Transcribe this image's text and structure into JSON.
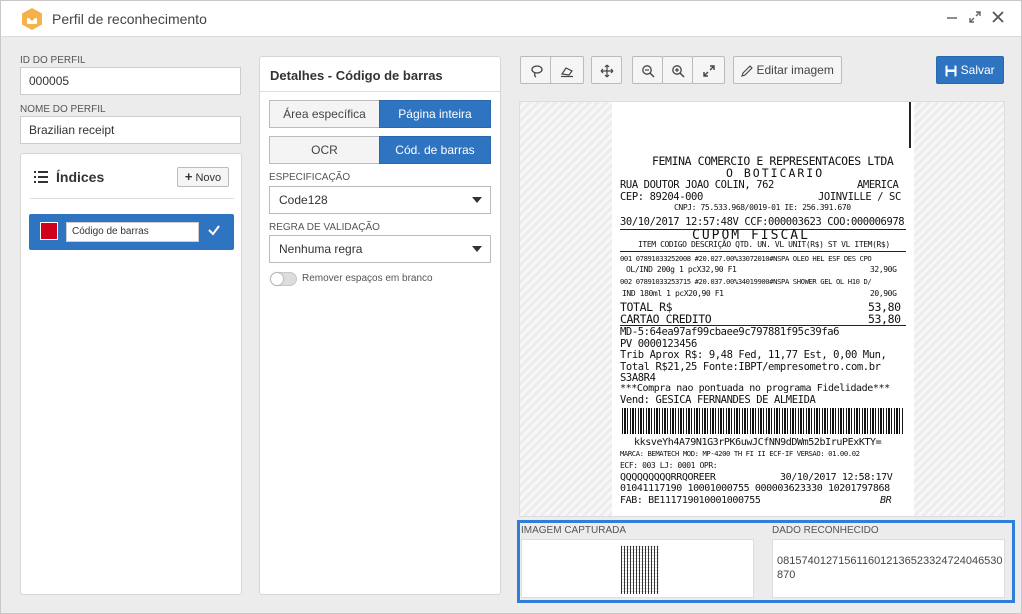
{
  "window": {
    "title": "Perfil de reconhecimento"
  },
  "left": {
    "id_label": "ID DO PERFIL",
    "id_value": "000005",
    "name_label": "NOME DO PERFIL",
    "name_value": "Brazilian receipt",
    "indices_title": "Índices",
    "new_button": "Novo",
    "index_item": {
      "label": "Código de barras",
      "color": "#d0021b"
    }
  },
  "details": {
    "title": "Detalhes - Código de barras",
    "area_specific": "Área específica",
    "full_page": "Página inteira",
    "ocr": "OCR",
    "barcode": "Cód. de barras",
    "spec_label": "ESPECIFICAÇÃO",
    "spec_value": "Code128",
    "rule_label": "REGRA DE VALIDAÇÃO",
    "rule_value": "Nenhuma regra",
    "remove_spaces": "Remover espaços em branco"
  },
  "toolbar": {
    "edit_image": "Editar imagem",
    "save": "Salvar"
  },
  "receipt": {
    "lines": [
      "FEMINA COMERCIO E REPRESENTACOES LTDA",
      "O BOTICARIO",
      "RUA DOUTOR JOAO COLIN, 762",
      "AMERICA",
      "CEP: 89204-000",
      "JOINVILLE / SC",
      "CNPJ: 75.533.968/0019-01 IE: 256.391.670",
      "30/10/2017 12:57:48V CCF:000003623 COO:000006978",
      "CUPOM FISCAL",
      "ITEM CODIGO DESCRIÇÃO QTD. UN. VL UNIT(R$) ST VL ITEM(R$)",
      "001 07891033252008 #20.027.00%33072010#NSPA OLEO HEL ESF DES CPO",
      "OL/IND 200g 1 pcX32,90 F1",
      "32,90G",
      "002 07891033253715 #20.037.00%34019900#NSPA SHOWER GEL OL H10 D/",
      "IND 180ml 1 pcX20,90 F1",
      "20,90G",
      "TOTAL R$",
      "53,80",
      "CARTAO CREDITO",
      "53,80",
      "MD-5:64ea97af99cbaee9c797881f95c39fa6",
      "PV 0000123456",
      "Trib Aprox R$: 9,48 Fed, 11,77 Est, 0,00 Mun,",
      "Total R$21,25 Fonte:IBPT/empresometro.com.br",
      "S3A8R4",
      "***Compra nao pontuada no programa Fidelidade***",
      "Vend: GESICA FERNANDES DE ALMEIDA",
      "kksveYh4A79N1G3rPK6uwJCfNN9dDWm52bIruPExKTY=",
      "MARCA: BEMATECH MOD: MP-4200 TH FI II ECF-IF VERSAO: 01.00.02",
      "ECF: 003 LJ: 0001 OPR:",
      "QQQQQQQQQRRQOREER",
      "30/10/2017 12:58:17V",
      "01041117190 10001000755 000003623330 10201797868",
      "FAB: BE111719010001000755",
      "BR"
    ]
  },
  "result": {
    "captured_label": "IMAGEM CAPTURADA",
    "recognized_label": "DADO RECONHECIDO",
    "recognized_value": "08157401271561160121365233247240465308​70"
  }
}
